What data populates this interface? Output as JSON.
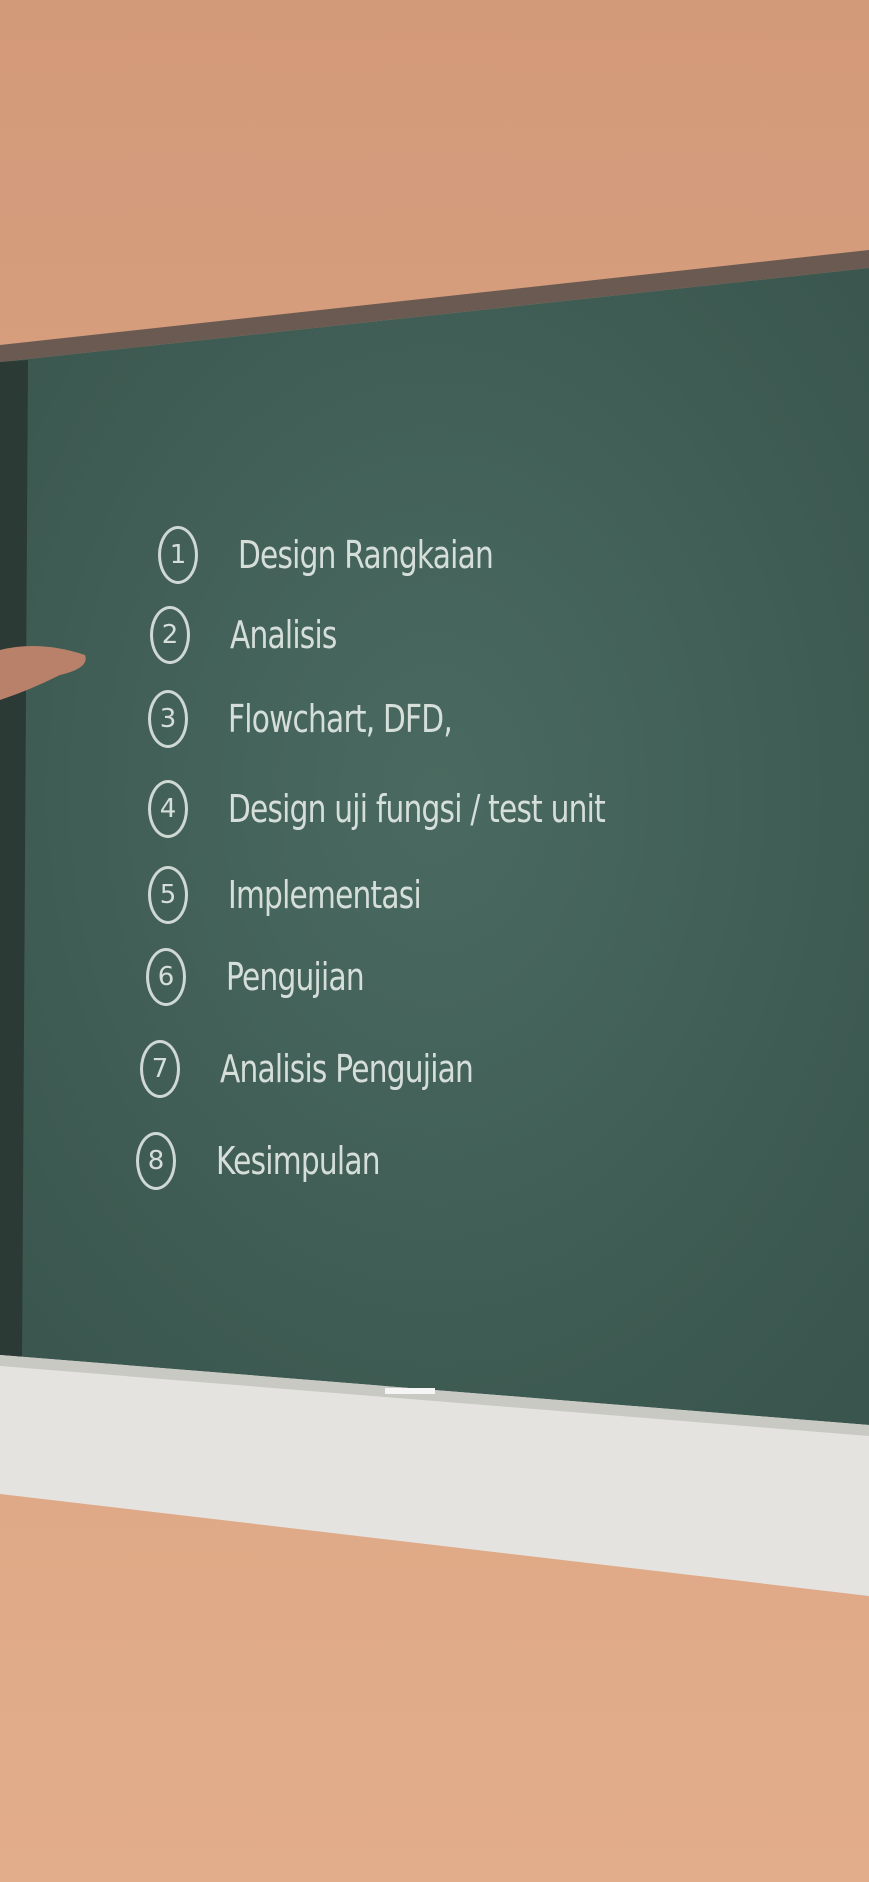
{
  "scene": {
    "description_colors": {
      "wall": "#d9a07e",
      "board": "#3f5d55",
      "frame": "#2e3d38",
      "tray": "#e6e6e2",
      "chalk": "#e6ece8"
    }
  },
  "board": {
    "items": [
      {
        "number": "1",
        "text": "Design Rangkaian"
      },
      {
        "number": "2",
        "text": "Analisis"
      },
      {
        "number": "3",
        "text": "Flowchart, DFD,"
      },
      {
        "number": "4",
        "text": "Design uji fungsi / test unit"
      },
      {
        "number": "5",
        "text": "Implementasi"
      },
      {
        "number": "6",
        "text": "Pengujian"
      },
      {
        "number": "7",
        "text": "Analisis Pengujian"
      },
      {
        "number": "8",
        "text": "Kesimpulan"
      }
    ]
  }
}
